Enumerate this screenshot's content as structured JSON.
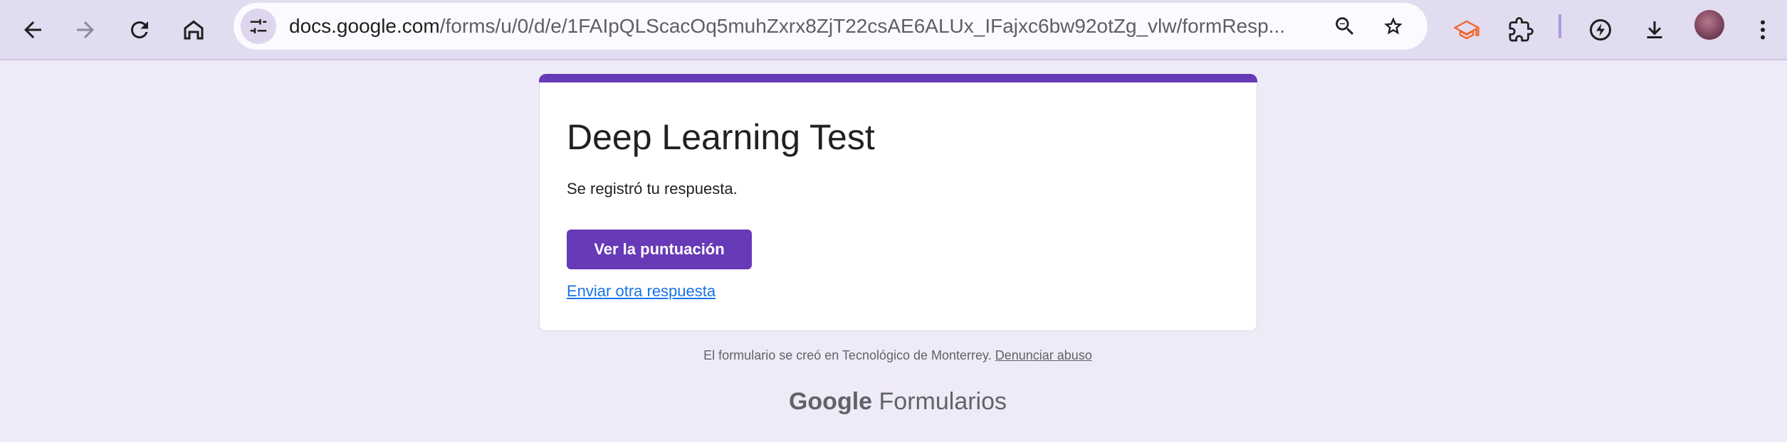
{
  "browser": {
    "url_host": "docs.google.com",
    "url_path": "/forms/u/0/d/e/1FAIpQLScacOq5muhZxrx8ZjT22csAE6ALUx_IFajxc6bw92otZg_vlw/formResp...",
    "icons": {
      "back": "arrow-left-icon",
      "forward": "arrow-right-icon",
      "reload": "reload-icon",
      "home": "home-icon",
      "site_info": "tune-icon",
      "zoom": "zoom-icon",
      "bookmark": "star-icon",
      "extension_1": "graduation-cap-icon",
      "extensions": "puzzle-icon",
      "performance": "speed-icon",
      "downloads": "download-icon",
      "menu": "kebab-menu-icon"
    }
  },
  "form": {
    "title": "Deep Learning Test",
    "confirmation": "Se registró tu respuesta.",
    "score_button": "Ver la puntuación",
    "another_link": "Enviar otra respuesta",
    "accent_color": "#673ab7"
  },
  "footer": {
    "note": "El formulario se creó en Tecnológico de Monterrey.",
    "abuse_link": "Denunciar abuso",
    "brand_google": "Google",
    "brand_product": "Formularios"
  }
}
